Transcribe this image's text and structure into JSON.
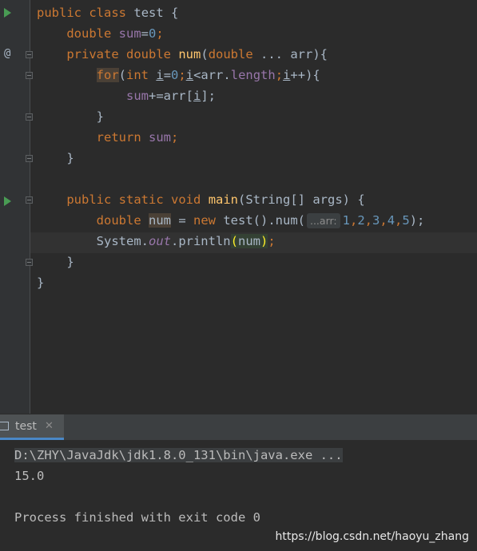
{
  "editor": {
    "lines": {
      "l1": {
        "public": "public",
        "class": "class",
        "name": "test",
        "brace": " {"
      },
      "l2": {
        "double": "double",
        "var": "sum",
        "eq": "=",
        "val": "0",
        "semi": ";"
      },
      "l3": {
        "private": "private",
        "double": "double",
        "fn": "num",
        "paren": "(",
        "ptype": "double",
        "rest": " ... arr){"
      },
      "l4": {
        "for": "for",
        "open": "(",
        "int": "int",
        "i1": "i",
        "eq": "=",
        "zero": "0",
        "semi1": ";",
        "i2": "i",
        "lt": "<arr.",
        "length": "length",
        "semi2": ";",
        "i3": "i",
        "inc": "++){"
      },
      "l5": {
        "sum": "sum",
        "rest": "+=arr[",
        "i": "i",
        "close": "];"
      },
      "l6": {
        "brace": "}"
      },
      "l7": {
        "return": "return",
        "sum": "sum",
        "semi": ";"
      },
      "l8": {
        "brace": "}"
      },
      "l9": {
        "public": "public",
        "static": "static",
        "void": "void",
        "fn": "main",
        "rest": "(String[] args) {"
      },
      "l10": {
        "double": "double",
        "var": "num",
        "eq": " = ",
        "new": "new",
        "call": " test().num(",
        "hint": "...arr:",
        "a1": "1",
        "a2": "2",
        "a3": "3",
        "a4": "4",
        "a5": "5",
        "close": ");"
      },
      "l11": {
        "sys": "System.",
        "out": "out",
        "println": ".println",
        "p1": "(",
        "arg": "num",
        "p2": ")",
        "semi": ";"
      },
      "l12": {
        "brace": "}"
      },
      "l13": {
        "brace": "}"
      }
    }
  },
  "run_panel": {
    "tab_label": "test",
    "close_glyph": "✕",
    "console": {
      "command": "D:\\ZHY\\JavaJdk\\jdk1.8.0_131\\bin\\java.exe ...",
      "output": "15.0",
      "exit": "Process finished with exit code 0"
    }
  },
  "watermark": "https://blog.csdn.net/haoyu_zhang",
  "colors": {
    "keyword": "#cc7832",
    "function": "#ffc66d",
    "field": "#9876aa",
    "number": "#6897bb",
    "text": "#a9b7c6",
    "background": "#2b2b2b",
    "run_icon": "#499c54"
  }
}
